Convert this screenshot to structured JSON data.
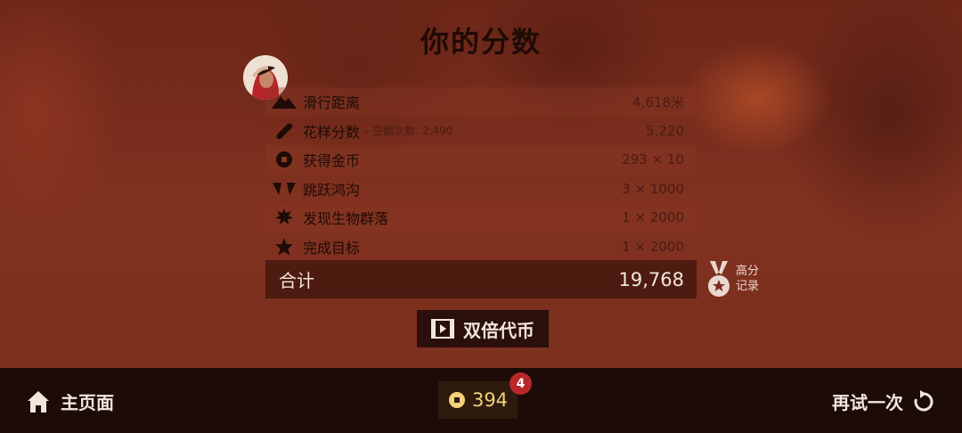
{
  "title": "你的分数",
  "rows": [
    {
      "label": "滑行距离",
      "sub": "",
      "value": "4,618米",
      "icon": "mountain-icon"
    },
    {
      "label": "花样分数",
      "sub": "- 空翻次数: 2,490",
      "value": "5,220",
      "icon": "snowboard-icon"
    },
    {
      "label": "获得金币",
      "sub": "",
      "value": "293 × 10",
      "icon": "coin-icon"
    },
    {
      "label": "跳跃鸿沟",
      "sub": "",
      "value": "3 × 1000",
      "icon": "chasm-icon"
    },
    {
      "label": "发现生物群落",
      "sub": "",
      "value": "1 × 2000",
      "icon": "leaf-icon"
    },
    {
      "label": "完成目标",
      "sub": "",
      "value": "1 × 2000",
      "icon": "star-icon"
    }
  ],
  "total": {
    "label": "合计",
    "value": "19,768"
  },
  "record": {
    "line1": "高分",
    "line2": "记录",
    "icon": "medal-icon"
  },
  "double_coins": {
    "label": "双倍代币",
    "icon": "video-play-icon"
  },
  "bottom": {
    "home_label": "主页面",
    "coins": "394",
    "badge": "4",
    "retry_label": "再试一次"
  },
  "colors": {
    "accent": "#b8282a",
    "coin": "#f2d27a",
    "panel": "#2a0f0a"
  }
}
